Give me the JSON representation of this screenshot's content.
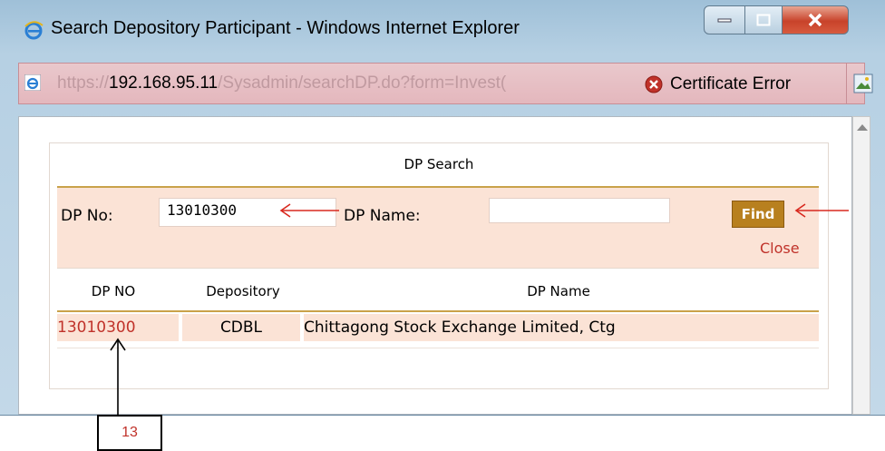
{
  "window": {
    "title": "Search Depository Participant - Windows Internet Explorer"
  },
  "address": {
    "url_prefix": "https://",
    "url_host": "192.168.95.11",
    "url_path": "/Sysadmin/searchDP.do?form=Invest(",
    "cert_error": "Certificate Error"
  },
  "search": {
    "title": "DP Search",
    "dp_no_label": "DP No:",
    "dp_no_value": "13010300",
    "dp_name_label": "DP Name:",
    "dp_name_value": "",
    "find_label": "Find",
    "close_label": "Close"
  },
  "results": {
    "columns": [
      "DP NO",
      "Depository",
      "DP Name"
    ],
    "rows": [
      [
        "13010300",
        "CDBL",
        "Chittagong Stock Exchange Limited, Ctg"
      ]
    ]
  },
  "annotation": {
    "label": "13"
  },
  "colors": {
    "row_highlight": "#fbe3d6",
    "accent_gold": "#c9a24a",
    "find_button": "#b8801f",
    "link_red": "#c0322a"
  }
}
